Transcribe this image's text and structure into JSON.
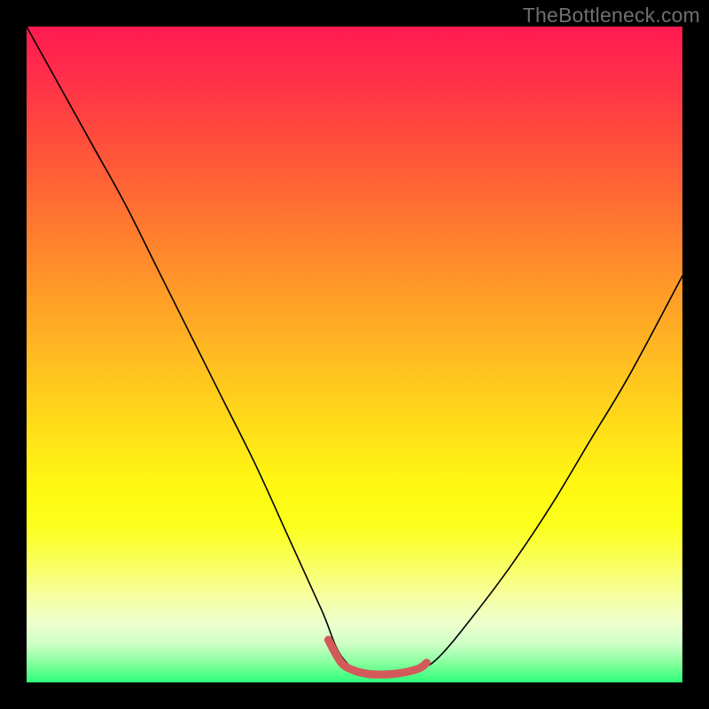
{
  "watermark": "TheBottleneck.com",
  "chart_data": {
    "type": "line",
    "title": "",
    "xlabel": "",
    "ylabel": "",
    "xlim": [
      0,
      100
    ],
    "ylim": [
      0,
      100
    ],
    "background_gradient": {
      "top": "#ff1a50",
      "bottom": "#2dff79",
      "orientation": "vertical"
    },
    "series": [
      {
        "name": "bottleneck-curve",
        "color": "#000000",
        "x": [
          0,
          5,
          10,
          15,
          20,
          25,
          30,
          35,
          40,
          45,
          48,
          52,
          56,
          60,
          63,
          68,
          74,
          80,
          86,
          92,
          100
        ],
        "values": [
          100,
          91,
          82,
          73,
          63,
          53,
          43,
          33,
          22,
          11,
          4,
          1,
          1,
          2,
          4,
          10,
          18,
          27,
          37,
          47,
          62
        ]
      }
    ],
    "highlight": {
      "name": "optimal-flat-region",
      "color": "#d35a5a",
      "x": [
        46,
        48,
        50,
        52,
        54,
        56,
        58,
        60,
        61
      ],
      "values": [
        6.5,
        3,
        1.8,
        1.3,
        1.2,
        1.3,
        1.6,
        2.2,
        3.0
      ]
    }
  }
}
